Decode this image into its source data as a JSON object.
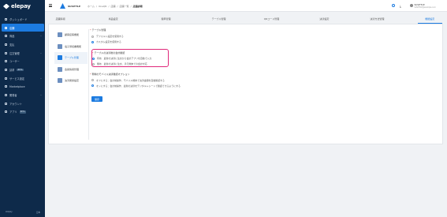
{
  "app": {
    "logo": "elepay"
  },
  "sidebar": {
    "items": [
      {
        "label": "ダッシュボード",
        "icon": "dashboard-icon",
        "active": false
      },
      {
        "label": "店舗",
        "icon": "store-icon",
        "active": true
      },
      {
        "label": "商品",
        "icon": "product-icon",
        "active": false,
        "chevron": "⌄"
      },
      {
        "label": "支払",
        "icon": "payment-icon",
        "active": false
      },
      {
        "label": "注文管理",
        "icon": "order-icon",
        "active": false,
        "chevron": "⌄"
      },
      {
        "label": "ユーザー",
        "icon": "user-icon",
        "active": false
      },
      {
        "label": "請求",
        "icon": "billing-icon",
        "active": false,
        "badge": "BETA"
      },
      {
        "label": "サービス設定",
        "icon": "service-icon",
        "active": false,
        "chevron": "⌄"
      },
      {
        "label": "Marketplace",
        "icon": "marketplace-icon",
        "active": false
      },
      {
        "label": "開発者",
        "icon": "developer-icon",
        "active": false,
        "chevron": "⌄"
      },
      {
        "label": "アカウント",
        "icon": "account-icon",
        "active": false
      },
      {
        "label": "アプリ",
        "icon": "app-icon",
        "active": false,
        "badge": "BETA"
      }
    ],
    "footer_left": "elepay",
    "footer_right": "日本"
  },
  "topbar": {
    "store_name": "SUSITTLE",
    "breadcrumb": [
      "ホーム",
      "OneQR",
      "店舗",
      "店舗一覧",
      "店舗詳細"
    ],
    "user_name": "SUSITTLE",
    "user_sub": "SUSITTLE@example.com"
  },
  "tabs": [
    "店舗情報",
    "商品設定",
    "税率管理",
    "テーブル管理",
    "QRコード管理",
    "決済設定",
    "決済方法管理",
    "機能設定"
  ],
  "active_tab": 7,
  "subnav": [
    {
      "label": "顧客接客機能",
      "active": false
    },
    {
      "label": "電子領収書機能",
      "active": false
    },
    {
      "label": "テーブル管理",
      "active": true
    },
    {
      "label": "会員情報管理",
      "active": false
    },
    {
      "label": "決済関係設定",
      "active": false
    }
  ],
  "settings": {
    "table_mgmt": {
      "title": "テーブル管理",
      "options": [
        "デフォルト設定を使用する",
        "カスタム設定を使用する"
      ],
      "selected": 1
    },
    "order_status": {
      "title": "テーブルの決済後の会計確認",
      "options": [
        "有効　最新の決済に注文から会計アプリを自動で入力",
        "無効　最新の決済に注文、手元端末での会計対応"
      ],
      "selected": 0
    },
    "mobile_mode": {
      "title": "現場のモバイル決済確認オプション",
      "options": [
        "オフにする：会計前操作、モバイル端末で決済金額を自動確認する",
        "オンにする：会計前操作、最新の決済をデジタルレシートで確認できるようにする"
      ],
      "selected": 1
    },
    "save_label": "保存"
  },
  "colors": {
    "sidebar": "#0e2a4a",
    "accent": "#1c7be0",
    "highlight": "#e0287a"
  }
}
